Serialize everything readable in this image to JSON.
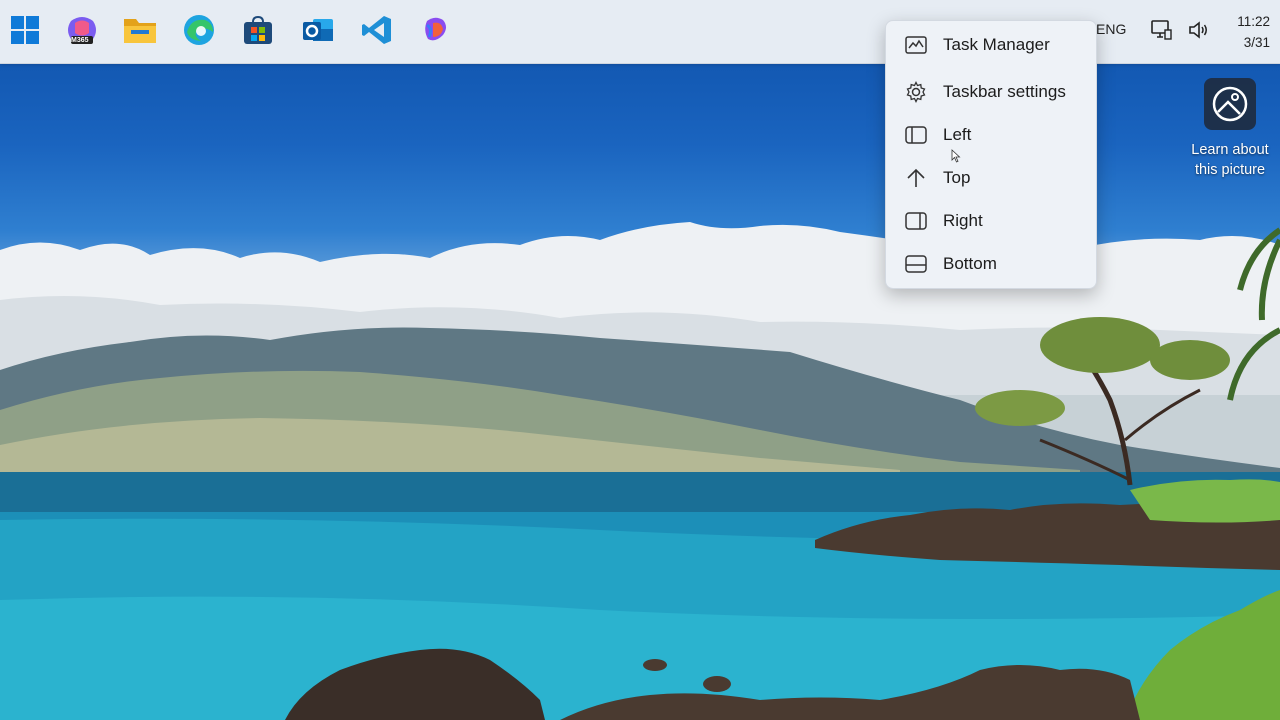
{
  "taskbar": {
    "apps": [
      {
        "name": "start-icon"
      },
      {
        "name": "microsoft-365-copilot-icon",
        "badge": "M365"
      },
      {
        "name": "file-explorer-icon"
      },
      {
        "name": "edge-icon"
      },
      {
        "name": "microsoft-store-icon"
      },
      {
        "name": "outlook-icon",
        "letter": "o"
      },
      {
        "name": "vscode-icon"
      },
      {
        "name": "copilot-icon"
      }
    ],
    "tray": {
      "language": "ENG",
      "network_icon": "network-icon",
      "volume_icon": "volume-icon",
      "time": "11:22",
      "date": "3/31"
    }
  },
  "context_menu": {
    "items": [
      {
        "label": "Task Manager",
        "icon": "task-manager-icon"
      },
      {
        "label": "Taskbar settings",
        "icon": "gear-icon"
      },
      {
        "label": "Left",
        "icon": "dock-left-icon"
      },
      {
        "label": "Top",
        "icon": "arrow-up-icon"
      },
      {
        "label": "Right",
        "icon": "dock-right-icon"
      },
      {
        "label": "Bottom",
        "icon": "dock-bottom-icon"
      }
    ]
  },
  "desktop": {
    "spotlight_label_line1": "Learn about",
    "spotlight_label_line2": "this picture",
    "spotlight_icon": "spotlight-picture-icon"
  },
  "colors": {
    "taskbar_bg": "#e6ecf3",
    "menu_bg": "#eef2f7",
    "accent_blue": "#0078d4"
  }
}
